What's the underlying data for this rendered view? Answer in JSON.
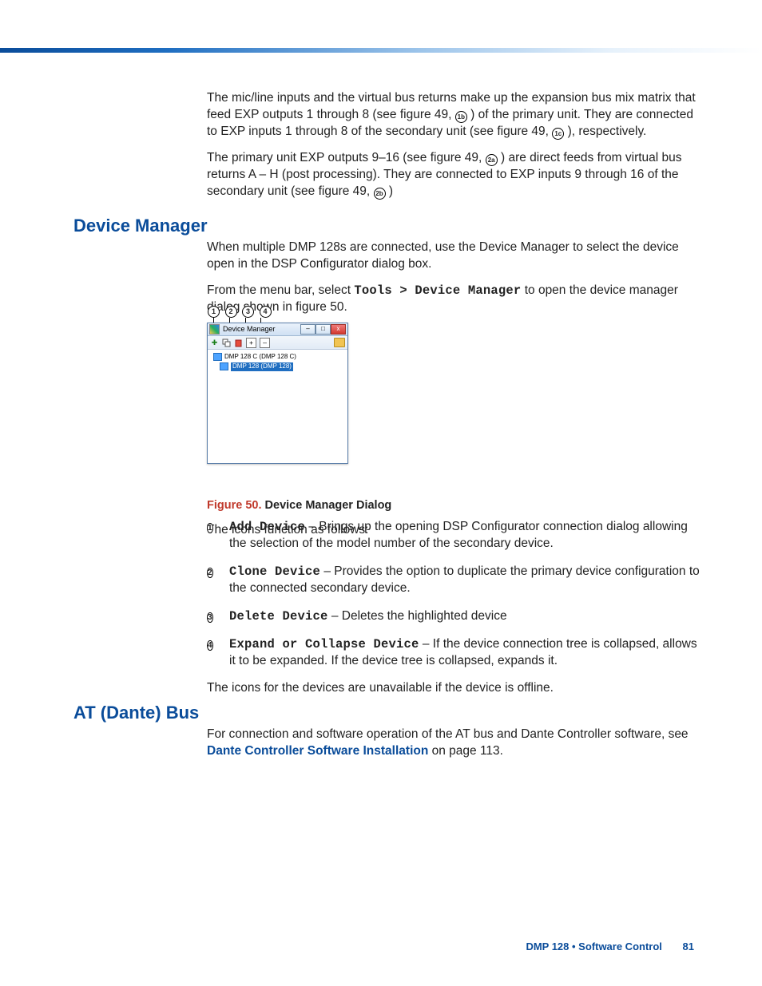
{
  "para1": "The mic/line inputs and the virtual bus returns make up the expansion bus mix matrix that feed EXP outputs 1 through 8 (see figure 49, ",
  "para1_ref": "1b",
  "para1_b": ") of the primary unit. They are connected to EXP inputs 1 through 8 of the secondary unit (see figure 49, ",
  "para1_ref2": "1c",
  "para1_c": "), respectively.",
  "para2": "The primary unit EXP outputs 9–16 (see figure 49, ",
  "para2_ref": "2a",
  "para2_b": ") are direct feeds from virtual bus returns A – H (post processing). They are connected to EXP inputs 9 through 16 of the secondary unit (see figure 49, ",
  "para2_ref2": "2b",
  "para2_c": ")",
  "h_dm": "Device Manager",
  "dm_p1": "When multiple DMP 128s are connected, use the Device Manager to select the device open in the DSP Configurator dialog box.",
  "dm_p2a": "From the menu bar, select ",
  "dm_p2b": "Tools > Device Manager",
  "dm_p2c": " to open the device manager dialog shown in figure 50.",
  "dm_win_title": "Device Manager",
  "dm_tree": {
    "item1": "DMP 128 C (DMP 128 C)",
    "item2": "DMP 128 (DMP 128)"
  },
  "callout_nums": {
    "c1": "1",
    "c2": "2",
    "c3": "3",
    "c4": "4"
  },
  "fig_caption_num": "Figure 50.",
  "fig_caption_txt": "  Device Manager Dialog",
  "fn_intro": "The icons function as follows:",
  "fn": [
    {
      "num": "1",
      "name": "Add Device",
      "desc": " – Brings up the opening DSP Configurator connection dialog  allowing the selection of the model number of the secondary device."
    },
    {
      "num": "2",
      "name": "Clone Device",
      "desc": " – Provides the option to duplicate the primary device configuration to the connected secondary device."
    },
    {
      "num": "3",
      "name": "Delete Device",
      "desc": " – Deletes the highlighted device"
    },
    {
      "num": "4",
      "name": "Expand or Collapse Device",
      "desc": " – If the device connection tree is collapsed, allows it to be expanded. If the device tree is collapsed, expands it."
    }
  ],
  "fn_outro": "The icons for the devices are unavailable if the device is offline.",
  "h_at": "AT (Dante) Bus",
  "at_p1a": "For connection and software operation of the AT bus and Dante Controller software, see ",
  "at_link": "Dante Controller Software Installation",
  "at_p1b": " on page 113.",
  "footer_doc": "DMP 128 • Software Control",
  "footer_page": "81",
  "tb_plus": "+",
  "tb_minus": "–",
  "wbtn_min": "–",
  "wbtn_max": "□",
  "wbtn_close": "x"
}
